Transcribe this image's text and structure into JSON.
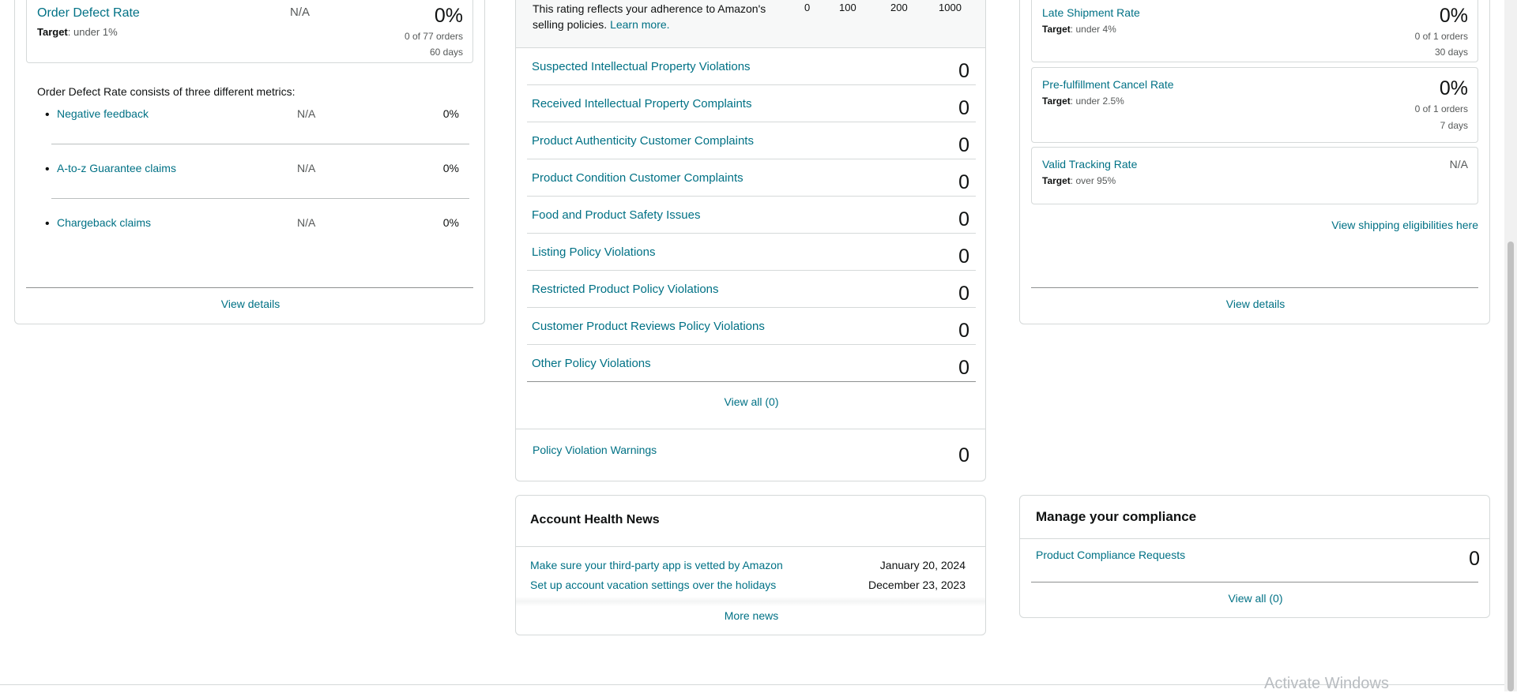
{
  "left": {
    "odr": {
      "title": "Order Defect Rate",
      "target_label": "Target",
      "target_value": ": under 1%",
      "na": "N/A",
      "value": "0%",
      "orders": "0 of 77 orders",
      "days": "60 days"
    },
    "consists_text": "Order Defect Rate consists of three different metrics:",
    "metrics": [
      {
        "label": "Negative feedback",
        "na": "N/A",
        "value": "0%"
      },
      {
        "label": "A-to-z Guarantee claims",
        "na": "N/A",
        "value": "0%"
      },
      {
        "label": "Chargeback claims",
        "na": "N/A",
        "value": "0%"
      }
    ],
    "view_details": "View details"
  },
  "middle": {
    "rating_text": "This rating reflects your adherence to Amazon's selling policies.",
    "learn_more": "Learn more.",
    "scale_labels": [
      "0",
      "100",
      "200",
      "1000"
    ],
    "rating_level": 0,
    "policies": [
      {
        "label": "Suspected Intellectual Property Violations",
        "value": "0"
      },
      {
        "label": "Received Intellectual Property Complaints",
        "value": "0"
      },
      {
        "label": "Product Authenticity Customer Complaints",
        "value": "0"
      },
      {
        "label": "Product Condition Customer Complaints",
        "value": "0"
      },
      {
        "label": "Food and Product Safety Issues",
        "value": "0"
      },
      {
        "label": "Listing Policy Violations",
        "value": "0"
      },
      {
        "label": "Restricted Product Policy Violations",
        "value": "0"
      },
      {
        "label": "Customer Product Reviews Policy Violations",
        "value": "0"
      },
      {
        "label": "Other Policy Violations",
        "value": "0"
      }
    ],
    "view_all": "View all (0)",
    "warnings": {
      "label": "Policy Violation Warnings",
      "value": "0"
    }
  },
  "news": {
    "title": "Account Health News",
    "items": [
      {
        "label": "Make sure your third-party app is vetted by Amazon",
        "date": "January 20, 2024"
      },
      {
        "label": "Set up account vacation settings over the holidays",
        "date": "December 23, 2023"
      }
    ],
    "more": "More news"
  },
  "right": {
    "late": {
      "title": "Late Shipment Rate",
      "target_label": "Target",
      "target_value": ": under 4%",
      "value": "0%",
      "orders": "0 of 1 orders",
      "days": "30 days"
    },
    "cancel": {
      "title": "Pre-fulfillment Cancel Rate",
      "target_label": "Target",
      "target_value": ": under 2.5%",
      "value": "0%",
      "orders": "0 of 1 orders",
      "days": "7 days"
    },
    "tracking": {
      "title": "Valid Tracking Rate",
      "target_label": "Target",
      "target_value": ": over 95%",
      "na": "N/A"
    },
    "shipping_link": "View shipping eligibilities here",
    "view_details": "View details"
  },
  "compliance": {
    "title": "Manage your compliance",
    "item": {
      "label": "Product Compliance Requests",
      "value": "0"
    },
    "view_all": "View all (0)"
  },
  "watermark": "Activate Windows",
  "colors": {
    "link": "#007185",
    "bar_green": "#538000",
    "bar_grey": "#d5d9d9",
    "border": "#d5d9d9"
  }
}
